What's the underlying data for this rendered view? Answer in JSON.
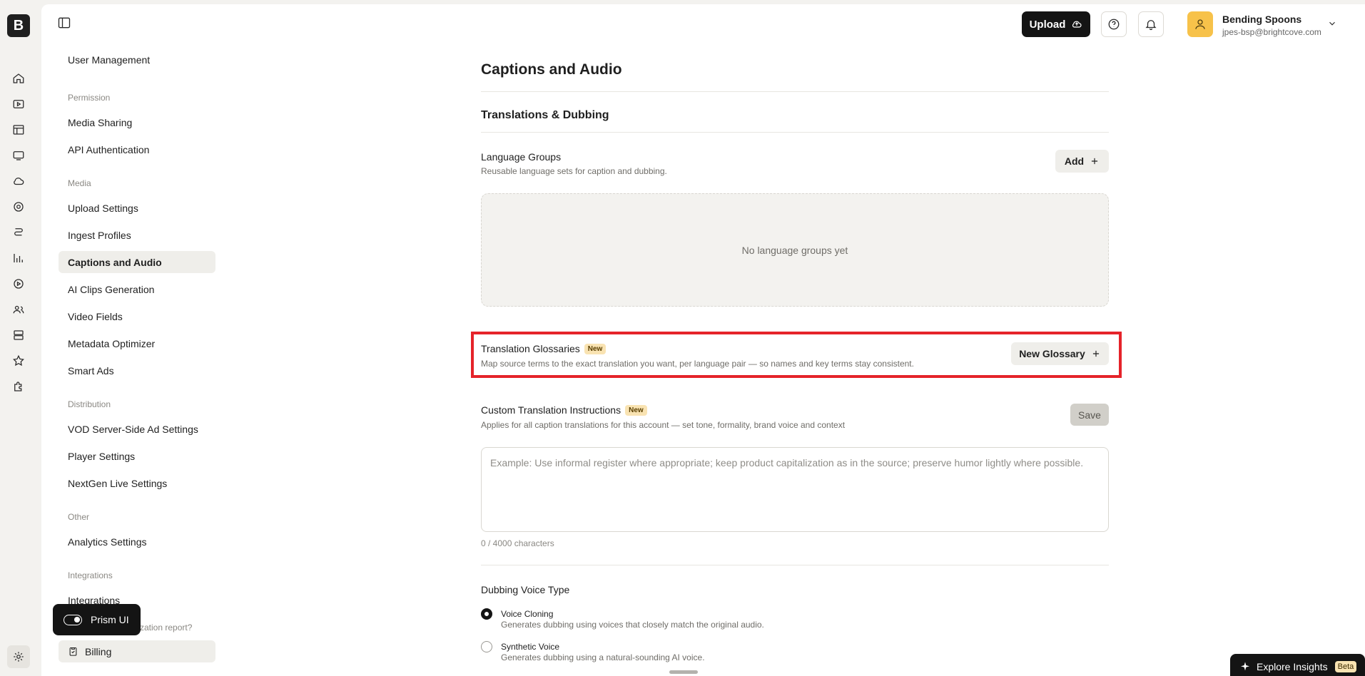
{
  "topbar": {
    "upload_label": "Upload",
    "user_name": "Bending Spoons",
    "user_email": "jpes-bsp@brightcove.com"
  },
  "nav": {
    "clipped_item": "User Management",
    "sections": {
      "permission": "Permission",
      "media": "Media",
      "distribution": "Distribution",
      "other": "Other",
      "integrations": "Integrations"
    },
    "items": {
      "media_sharing": "Media Sharing",
      "api_auth": "API Authentication",
      "upload_settings": "Upload Settings",
      "ingest_profiles": "Ingest Profiles",
      "captions_audio": "Captions and Audio",
      "ai_clips": "AI Clips Generation",
      "video_fields": "Video Fields",
      "metadata_optimizer": "Metadata Optimizer",
      "smart_ads": "Smart Ads",
      "vod_ssai": "VOD Server-Side Ad Settings",
      "player_settings": "Player Settings",
      "nextgen_live": "NextGen Live Settings",
      "analytics_settings": "Analytics Settings",
      "integrations": "Integrations"
    },
    "peek_text": "zation report?",
    "billing": "Billing",
    "prism_label": "Prism UI"
  },
  "content": {
    "page_title": "Captions and Audio",
    "section_title": "Translations & Dubbing",
    "language_groups": {
      "title": "Language Groups",
      "desc": "Reusable language sets for caption and dubbing.",
      "add_label": "Add",
      "empty": "No language groups yet"
    },
    "glossaries": {
      "title": "Translation Glossaries",
      "badge": "New",
      "desc": "Map source terms to the exact translation you want, per language pair — so names and key terms stay consistent.",
      "button": "New Glossary"
    },
    "custom_instructions": {
      "title": "Custom Translation Instructions",
      "badge": "New",
      "desc": "Applies for all caption translations for this account — set tone, formality, brand voice and context",
      "save_label": "Save",
      "placeholder": "Example: Use informal register where appropriate; keep product capitalization as in the source; preserve humor lightly where possible.",
      "char_count": "0 / 4000 characters"
    },
    "dubbing": {
      "title": "Dubbing Voice Type",
      "options": [
        {
          "label": "Voice Cloning",
          "desc": "Generates dubbing using voices that closely match the original audio.",
          "selected": true
        },
        {
          "label": "Synthetic Voice",
          "desc": "Generates dubbing using a natural-sounding AI voice.",
          "selected": false
        }
      ]
    }
  },
  "explore": {
    "label": "Explore Insights",
    "badge": "Beta"
  },
  "colors": {
    "highlight": "#e5232a",
    "accent_dark": "#141414",
    "badge_bg": "#f9e3b2",
    "avatar_bg": "#f7c24a"
  }
}
